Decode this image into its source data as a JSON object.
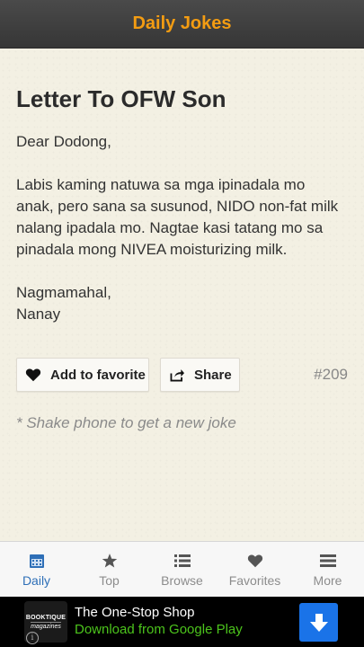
{
  "app": {
    "title": "Daily Jokes"
  },
  "joke": {
    "title": "Letter To OFW Son",
    "body": "Dear Dodong,\n\nLabis kaming natuwa sa mga ipinadala mo anak, pero sana sa susunod, NIDO non-fat milk nalang ipadala mo. Nagtae kasi tatang mo sa pinadala mong NIVEA moisturizing milk.\n\nNagmamahal,\nNanay",
    "number": "#209"
  },
  "actions": {
    "favorite_label": "Add to favorite",
    "share_label": "Share"
  },
  "hint": "* Shake phone to get a new joke",
  "tabs": [
    {
      "label": "Daily",
      "icon": "calendar-icon",
      "active": true
    },
    {
      "label": "Top",
      "icon": "star-icon",
      "active": false
    },
    {
      "label": "Browse",
      "icon": "list-icon",
      "active": false
    },
    {
      "label": "Favorites",
      "icon": "heart-icon",
      "active": false
    },
    {
      "label": "More",
      "icon": "menu-icon",
      "active": false
    }
  ],
  "ad": {
    "logo_line1": "BOOKTIQUE",
    "logo_line2": "magazines",
    "title": "The One-Stop Shop",
    "subtitle": "Download from Google Play",
    "info_glyph": "i"
  },
  "colors": {
    "accent": "#f39c12",
    "active_tab": "#2e6fb7",
    "ad_button": "#1a73e8"
  }
}
